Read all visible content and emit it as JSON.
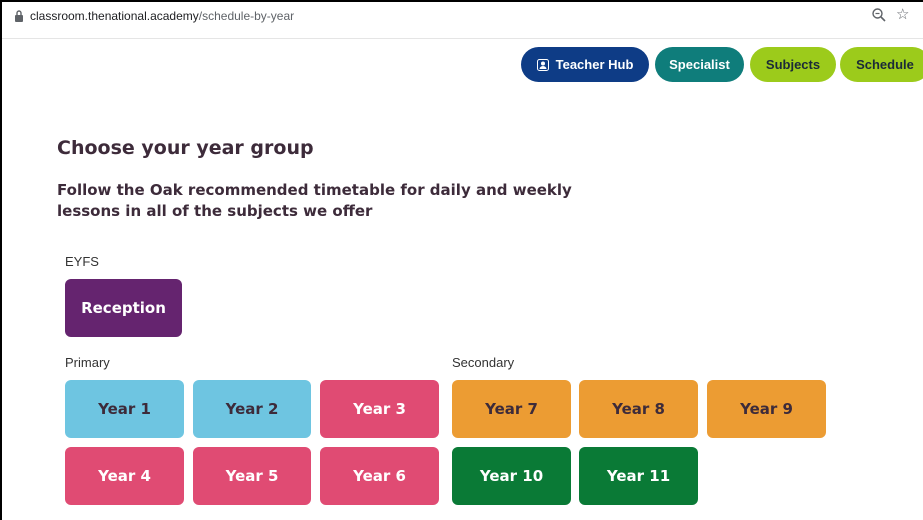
{
  "browser": {
    "url_host": "classroom.thenational.academy",
    "url_path": "/schedule-by-year",
    "star_glyph": "☆"
  },
  "nav": {
    "teacher_hub": "Teacher Hub",
    "specialist": "Specialist",
    "subjects": "Subjects",
    "schedule": "Schedule"
  },
  "page": {
    "title": "Choose your year group",
    "subtitle": "Follow the Oak recommended timetable for daily and weekly lessons in all of the subjects we offer"
  },
  "groups": {
    "eyfs": "EYFS",
    "primary": "Primary",
    "secondary": "Secondary"
  },
  "years": {
    "reception": "Reception",
    "y1": "Year 1",
    "y2": "Year 2",
    "y3": "Year 3",
    "y4": "Year 4",
    "y5": "Year 5",
    "y6": "Year 6",
    "y7": "Year 7",
    "y8": "Year 8",
    "y9": "Year 9",
    "y10": "Year 10",
    "y11": "Year 11"
  },
  "colors": {
    "teacher_hub": "#0e3c86",
    "specialist": "#0f7d7b",
    "lime": "#9ccb1b",
    "reception": "#65246f",
    "blue": "#6ec5e1",
    "pink": "#e04b73",
    "orange": "#ec9c33",
    "green": "#0a7a36"
  }
}
